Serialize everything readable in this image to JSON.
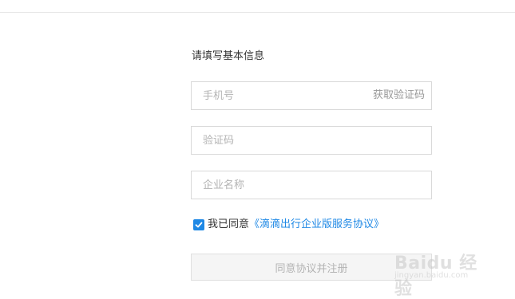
{
  "form": {
    "title": "请填写基本信息",
    "phone_placeholder": "手机号",
    "get_code_label": "获取验证码",
    "code_placeholder": "验证码",
    "company_placeholder": "企业名称",
    "agree_checked": true,
    "agree_text": "我已同意",
    "agreement_link": "《滴滴出行企业版服务协议》",
    "submit_label": "同意协议并注册"
  },
  "watermark": {
    "text": "Baidu 经验",
    "url": "jingyan.baidu.com"
  },
  "colors": {
    "accent": "#1e88e5",
    "border": "#d9d9d9",
    "placeholder": "#b3b3b3",
    "disabled_bg": "#f5f5f5"
  }
}
